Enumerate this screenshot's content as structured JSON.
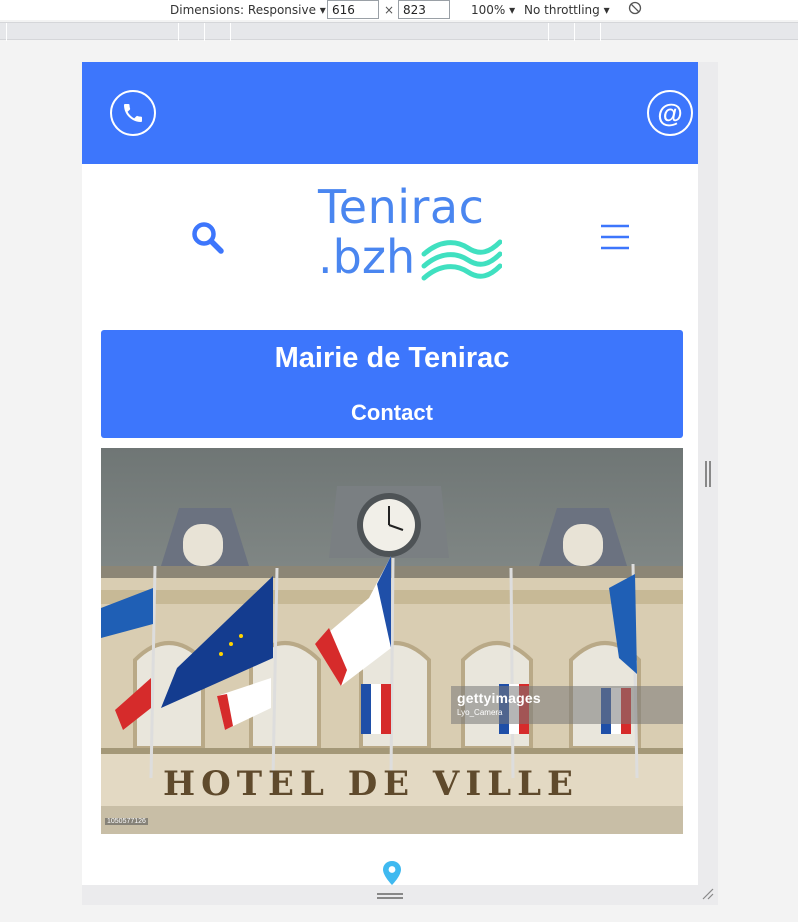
{
  "devtools": {
    "dimensions_label": "Dimensions: Responsive",
    "width_value": "616",
    "height_value": "823",
    "times": "×",
    "zoom": "100%",
    "throttling": "No throttling",
    "rotate_icon": "rotate-icon"
  },
  "topbar": {
    "background": "#3d76fc",
    "phone_icon": "phone-icon",
    "email_icon": "at-icon",
    "email_glyph": "@"
  },
  "header": {
    "logo_line1": "Tenirac",
    "logo_line2": ".bzh",
    "search_icon": "search-icon",
    "menu_icon": "hamburger-menu-icon"
  },
  "banner": {
    "title": "Mairie de Tenirac",
    "subtitle": "Contact"
  },
  "photo": {
    "facade_text": "HOTEL DE VILLE",
    "watermark_brand": "gettyimages",
    "watermark_credit": "Lyo_Camera",
    "image_id": "1050577126"
  },
  "footer": {
    "location_icon": "location-pin-icon"
  },
  "colors": {
    "primary": "#3d76fc",
    "logo_blue": "#4a86f0",
    "logo_wave": "#40e0c0",
    "pin": "#3fb9f0"
  }
}
